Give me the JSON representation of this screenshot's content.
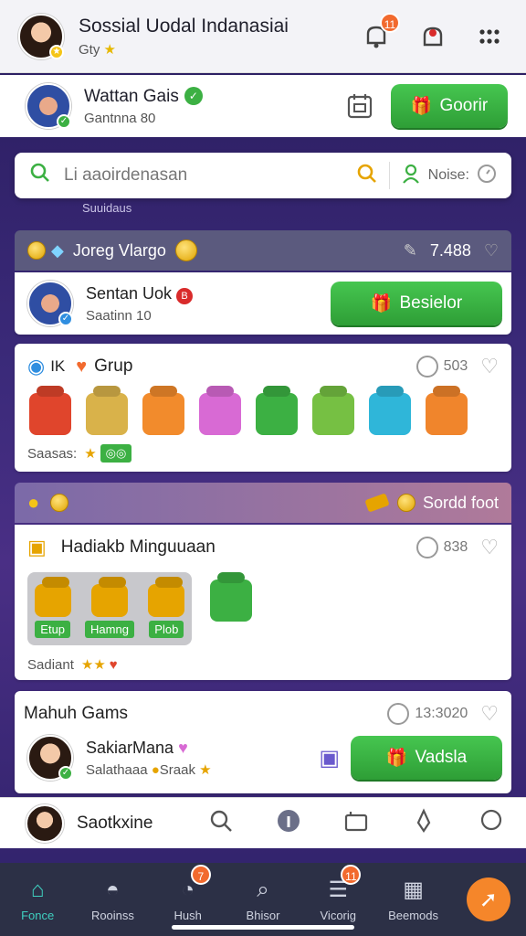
{
  "header": {
    "title": "Sossial Uodal Indanasiai",
    "subtitle": "Gty",
    "notif_count": "11"
  },
  "user": {
    "name": "Wattan Gais",
    "meta": "Gantnna 80",
    "cta": "Goorir"
  },
  "search": {
    "placeholder": "Li aaoirdenasan",
    "filter_label": "Noise:"
  },
  "behind_text": "Suuidaus",
  "section1": {
    "label": "Joreg Vlargo",
    "stat": "7.488"
  },
  "user2": {
    "name": "Sentan Uok",
    "meta": "Saatinn 10",
    "cta": "Besielor"
  },
  "group": {
    "label1": "IK",
    "label2": "Grup",
    "stat": "503",
    "footer": "Saasas:"
  },
  "section2": {
    "label": "Sordd foot"
  },
  "hadiah": {
    "title": "Hadiakb Minguuaan",
    "stat": "838",
    "chips": [
      "Etup",
      "Hamng",
      "Plob"
    ],
    "footer": "Sadiant"
  },
  "games": {
    "title": "Mahuh Gams",
    "stat": "13:3020",
    "name": "SakiarMana",
    "meta": "Salathaaa",
    "meta2": "Sraak",
    "cta": "Vadsla"
  },
  "profile_bar": {
    "label": "Saotkxine"
  },
  "nav": [
    {
      "label": "Fonce",
      "icon": "home-icon"
    },
    {
      "label": "Rooinss",
      "icon": "person-icon"
    },
    {
      "label": "Hush",
      "icon": "pie-icon",
      "badge": "7"
    },
    {
      "label": "Bhisor",
      "icon": "search-icon"
    },
    {
      "label": "Vicorig",
      "icon": "menu-icon",
      "badge": "11"
    },
    {
      "label": "Beemods",
      "icon": "calendar-icon"
    }
  ]
}
